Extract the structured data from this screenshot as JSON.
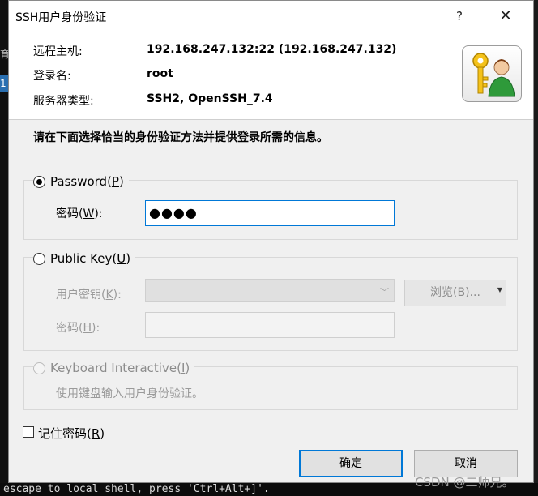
{
  "background": {
    "terminal_bottom_line": "escape to local shell, press 'Ctrl+Alt+]'.",
    "left_tab_fragment": "育",
    "left_tab_selected": "1"
  },
  "dialog": {
    "title": "SSH用户身份验证",
    "help_label": "?",
    "close_label": "✕"
  },
  "info": {
    "remote_host_label": "远程主机:",
    "remote_host_value": "192.168.247.132:22 (192.168.247.132)",
    "login_name_label": "登录名:",
    "login_name_value": "root",
    "server_type_label": "服务器类型:",
    "server_type_value": "SSH2, OpenSSH_7.4",
    "icon": "key-user-icon"
  },
  "instruction": "请在下面选择恰当的身份验证方法并提供登录所需的信息。",
  "password_method": {
    "label_prefix": "Password(",
    "mnemonic": "P",
    "label_suffix": ")",
    "selected": true,
    "field_label_prefix": "密码(",
    "field_mnemonic": "W",
    "field_label_suffix": "):",
    "value_masked": "●●●●"
  },
  "public_key_method": {
    "label_prefix": "Public Key(",
    "mnemonic": "U",
    "label_suffix": ")",
    "selected": false,
    "user_key_label_prefix": "用户密钥(",
    "user_key_mnemonic": "K",
    "user_key_label_suffix": "):",
    "user_key_value": "",
    "browse_prefix": "浏览(",
    "browse_mnemonic": "B",
    "browse_suffix": ")...",
    "passphrase_label_prefix": "密码(",
    "passphrase_mnemonic": "H",
    "passphrase_label_suffix": "):",
    "passphrase_value": ""
  },
  "keyboard_interactive": {
    "label_prefix": "Keyboard Interactive(",
    "mnemonic": "I",
    "label_suffix": ")",
    "description": "使用键盘输入用户身份验证。"
  },
  "remember_password": {
    "label_prefix": "记住密码(",
    "mnemonic": "R",
    "label_suffix": ")",
    "checked": false
  },
  "buttons": {
    "ok": "确定",
    "cancel": "取消"
  },
  "watermark": "CSDN @二师兄。"
}
